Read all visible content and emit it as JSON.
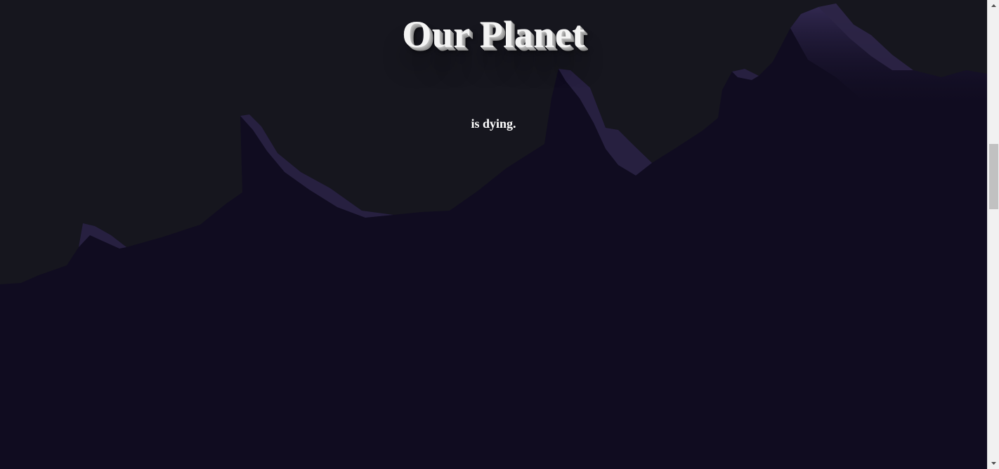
{
  "page": {
    "title": "Our Planet",
    "subtitle": "is dying."
  },
  "colors": {
    "sky": "#16161e",
    "mountain": "#100c20",
    "mountain_highlight": "#2c2546",
    "text": "#ffffff"
  },
  "icons": {
    "scroll_up": "chevron-up-icon",
    "scroll_down": "chevron-down-icon"
  }
}
